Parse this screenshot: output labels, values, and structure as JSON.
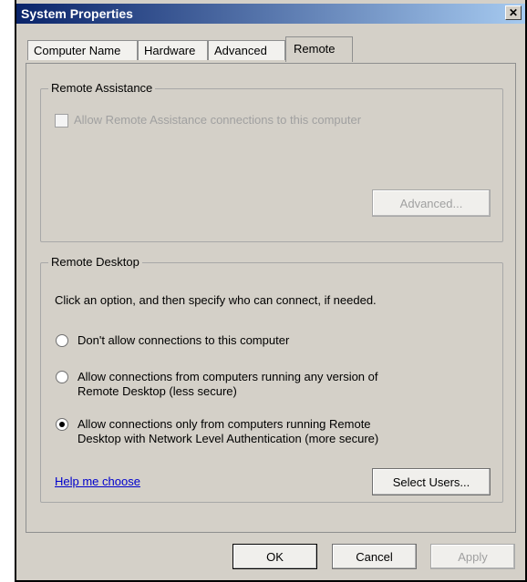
{
  "window": {
    "title": "System Properties",
    "close_glyph": "✕"
  },
  "tabs": [
    {
      "label": "Computer Name",
      "active": false
    },
    {
      "label": "Hardware",
      "active": false
    },
    {
      "label": "Advanced",
      "active": false
    },
    {
      "label": "Remote",
      "active": true
    }
  ],
  "remote_assistance": {
    "group_label": "Remote Assistance",
    "checkbox_label": "Allow Remote Assistance connections to this computer",
    "checkbox_checked": false,
    "checkbox_enabled": false,
    "advanced_button": "Advanced..."
  },
  "remote_desktop": {
    "group_label": "Remote Desktop",
    "instruction": "Click an option, and then specify who can connect, if needed.",
    "options": [
      {
        "line1": "Don't allow connections to this computer",
        "line2": "",
        "selected": false
      },
      {
        "line1": "Allow connections from computers running any version of",
        "line2": "Remote Desktop (less secure)",
        "selected": false
      },
      {
        "line1": "Allow connections only from computers running Remote",
        "line2": "Desktop with Network Level Authentication (more secure)",
        "selected": true
      }
    ],
    "help_link": "Help me choose",
    "select_users_button": "Select Users..."
  },
  "footer": {
    "ok_button": "OK",
    "cancel_button": "Cancel",
    "apply_button": "Apply"
  }
}
